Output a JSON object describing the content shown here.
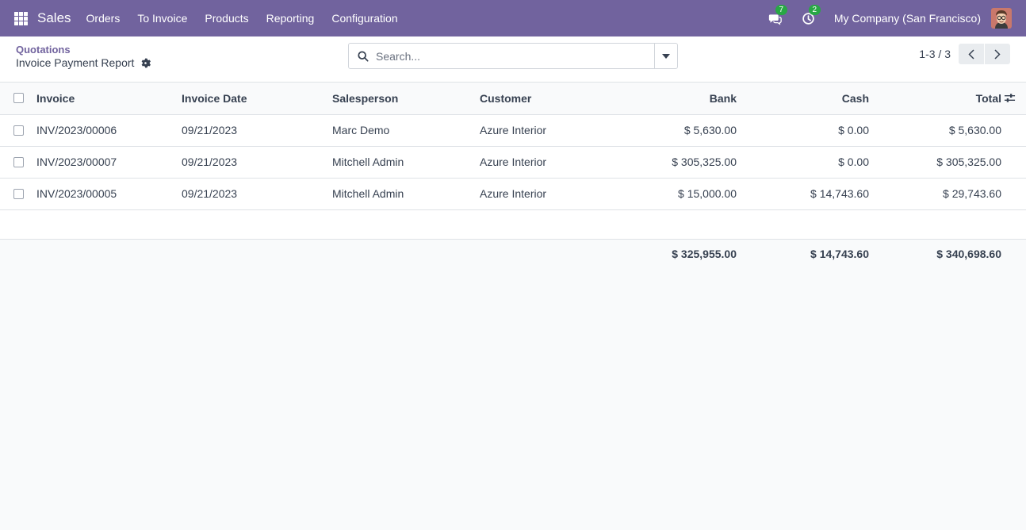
{
  "navbar": {
    "app_title": "Sales",
    "menu": [
      "Orders",
      "To Invoice",
      "Products",
      "Reporting",
      "Configuration"
    ],
    "messages_count": "7",
    "activities_count": "2",
    "company": "My Company (San Francisco)",
    "color": "#71639e"
  },
  "breadcrumb": {
    "parent": "Quotations",
    "current": "Invoice Payment Report"
  },
  "search": {
    "placeholder": "Search..."
  },
  "pager": {
    "value": "1-3 / 3"
  },
  "table": {
    "columns": [
      "Invoice",
      "Invoice Date",
      "Salesperson",
      "Customer",
      "Bank",
      "Cash",
      "Total"
    ],
    "rows": [
      {
        "invoice": "INV/2023/00006",
        "date": "09/21/2023",
        "salesperson": "Marc Demo",
        "customer": "Azure Interior",
        "bank": "$ 5,630.00",
        "cash": "$ 0.00",
        "total": "$ 5,630.00"
      },
      {
        "invoice": "INV/2023/00007",
        "date": "09/21/2023",
        "salesperson": "Mitchell Admin",
        "customer": "Azure Interior",
        "bank": "$ 305,325.00",
        "cash": "$ 0.00",
        "total": "$ 305,325.00"
      },
      {
        "invoice": "INV/2023/00005",
        "date": "09/21/2023",
        "salesperson": "Mitchell Admin",
        "customer": "Azure Interior",
        "bank": "$ 15,000.00",
        "cash": "$ 14,743.60",
        "total": "$ 29,743.60"
      }
    ],
    "totals": {
      "bank": "$ 325,955.00",
      "cash": "$ 14,743.60",
      "total": "$ 340,698.60"
    }
  },
  "icons": {
    "apps": "apps-grid-icon",
    "messages": "chat-icon",
    "activities": "clock-icon",
    "settings": "gear-icon",
    "search": "search-icon",
    "dropdown": "caret-down-icon",
    "prev": "chevron-left-icon",
    "next": "chevron-right-icon",
    "optional_columns": "sliders-icon"
  }
}
